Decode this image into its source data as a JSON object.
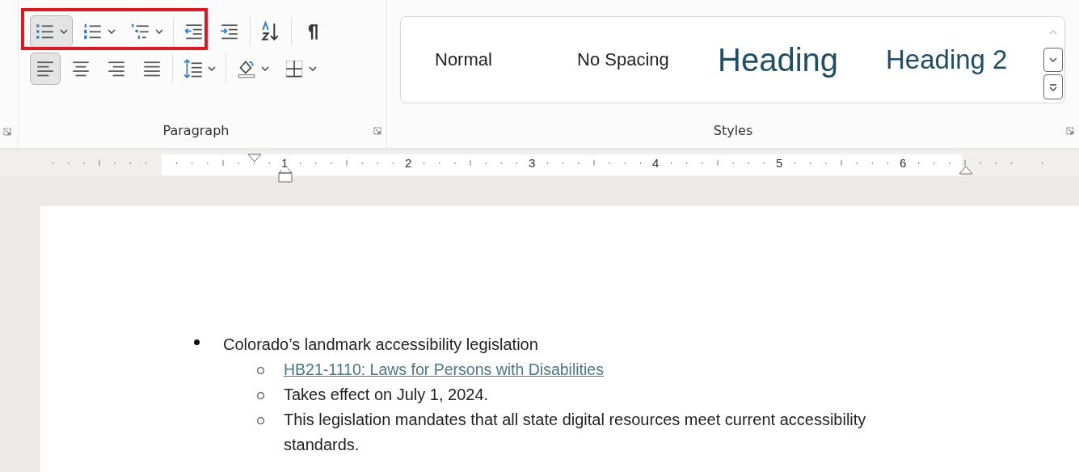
{
  "ribbon": {
    "paragraph": {
      "label": "Paragraph",
      "row_1": [
        {
          "selected": true,
          "dropdown": true
        },
        {
          "selected": false,
          "dropdown": true
        },
        {
          "selected": false,
          "dropdown": true
        },
        {
          "selected": false,
          "dropdown": false
        },
        {
          "selected": false,
          "dropdown": false
        },
        {
          "selected": false,
          "dropdown": false
        },
        {
          "selected": false,
          "dropdown": false
        }
      ],
      "row_2": [
        {
          "selected": true,
          "dropdown": false
        },
        {
          "selected": false,
          "dropdown": false
        },
        {
          "selected": false,
          "dropdown": false
        },
        {
          "selected": false,
          "dropdown": false
        },
        {
          "selected": false,
          "dropdown": true
        },
        {
          "selected": false,
          "dropdown": true
        },
        {
          "selected": false,
          "dropdown": true
        }
      ]
    },
    "styles": {
      "label": "Styles",
      "items": [
        {
          "label": "Normal",
          "kind": "normal"
        },
        {
          "label": "No Spacing",
          "kind": "normal"
        },
        {
          "label": "Heading",
          "kind": "heading1"
        },
        {
          "label": "Heading 2",
          "kind": "heading2"
        }
      ]
    }
  },
  "ruler": {
    "numbers": [
      "1",
      "2",
      "3",
      "4",
      "5",
      "6"
    ]
  },
  "document": {
    "list": [
      {
        "text": "Colorado’s landmark accessibility legislation",
        "children": [
          {
            "text": "HB21-1110: Laws for Persons with Disabilities",
            "kind": "link"
          },
          {
            "text": "Takes effect on July 1, 2024.",
            "kind": "text"
          },
          {
            "text": "This legislation mandates that all state digital resources meet current accessibility standards.",
            "kind": "text"
          }
        ]
      }
    ]
  }
}
